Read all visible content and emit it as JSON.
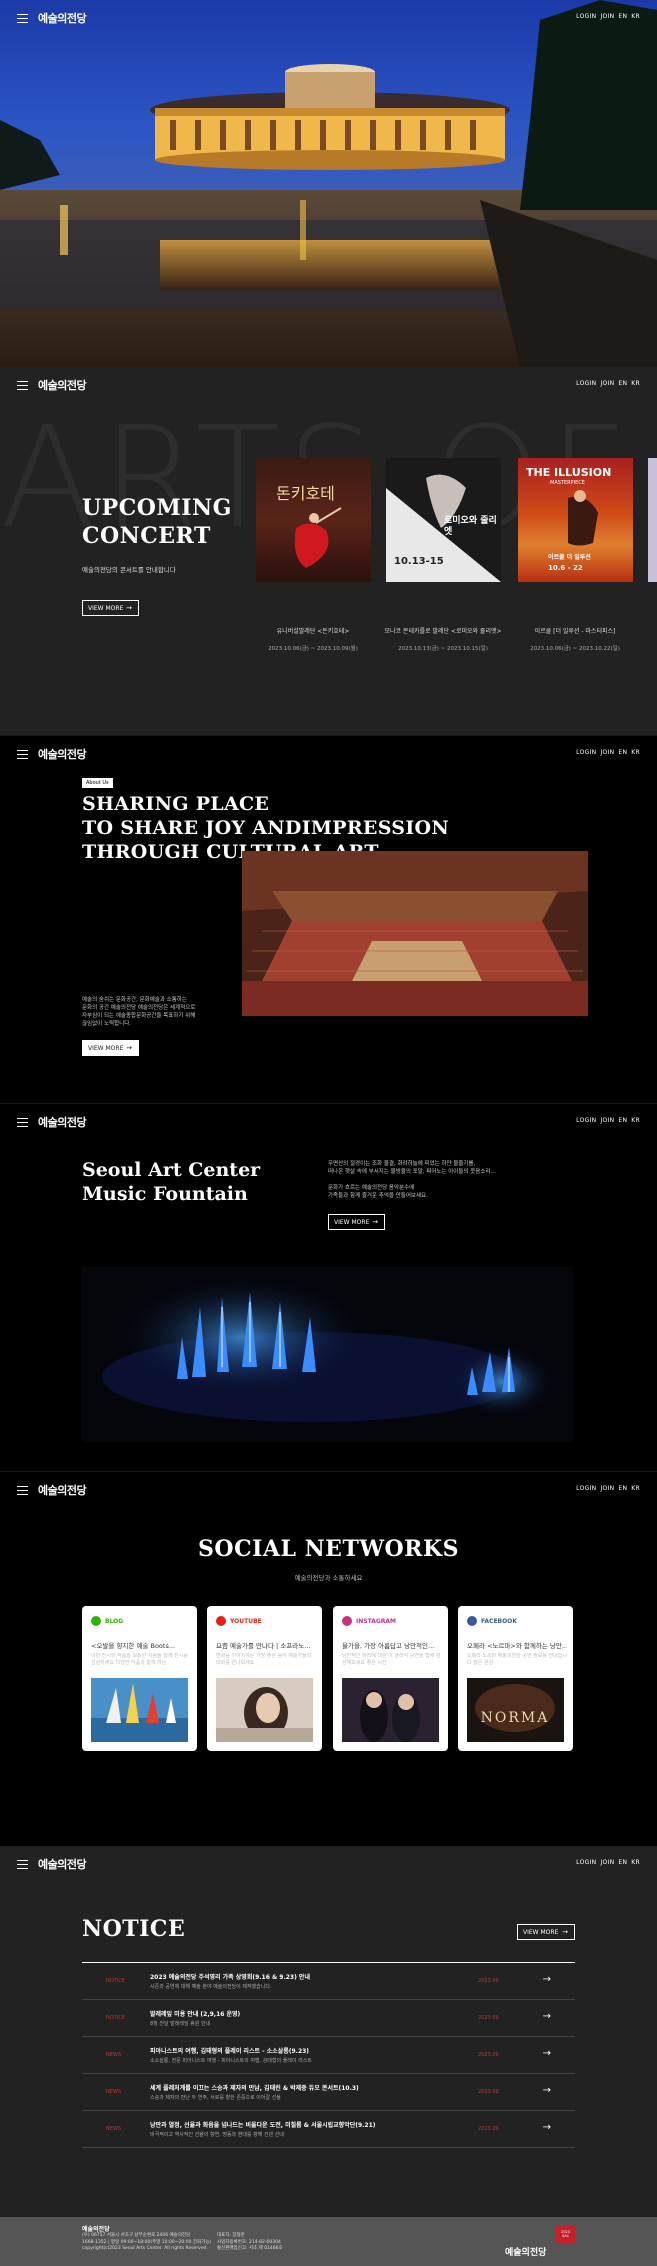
{
  "header": {
    "logo": "예술의전당",
    "login": "LOGIN",
    "join": "JOIN",
    "en": "EN",
    "kr": "KR"
  },
  "concert": {
    "bg_text": "ARTS OF",
    "title_line1": "UPCOMING",
    "title_line2": "CONCERT",
    "subtitle": "예술의전당의 콘서트를 안내합니다",
    "view_more": "VIEW MORE",
    "posters": [
      {
        "title": "유니버설발레단 <돈키호테>",
        "date": "2023.10.06(금) ~ 2023.10.09(월)",
        "poster_text": "돈키호테"
      },
      {
        "title": "모나코 몬테카를로 발레단 <로미오와 줄리엣>",
        "date": "2023.10.13(금) ~ 2023.10.15(일)",
        "poster_text": "로미오와 줄리엣",
        "poster_date": "10.13-15"
      },
      {
        "title": "이르쿨 [더 일루션 - 마스터피스]",
        "date": "2023.10.06(금) ~ 2023.10.22(일)",
        "poster_text": "THE ILLUSION",
        "poster_sub": "MASTERPIECE",
        "poster_kr": "이르쿨 더 일루션",
        "poster_date": "10.6 - 22"
      }
    ]
  },
  "about": {
    "tag": "About Us",
    "title_line1": "SHARING PLACE",
    "title_line2": "TO SHARE JOY ANDIMPRESSION",
    "title_line3": "THROUGH CULTURAL ART",
    "desc_line1": "예술의 숨쉬는 문화공간, 문화예술과 소통하는",
    "desc_line2": "문화의 공간 예술의전당 예술의전당은 세계적으로",
    "desc_line3": "자부심이 되는 예술종합문화공간을 목표하기 위해",
    "desc_line4": "끊임없이 노력합니다.",
    "view_more": "VIEW MORE"
  },
  "fountain": {
    "title_line1": "Seoul Art Center",
    "title_line2": "Music Fountain",
    "desc_line1": "우면산의 절경이는 조화 물결, 화려하늘에 피었는 하얀 물줄기를,",
    "desc_line2": "떠나온 햇살 속에 부서지는 물방울의 포말, 찌어노는 아이들의 웃음소리...",
    "desc_line3": "문화가 흐르는 예술의전당 음악분수에",
    "desc_line4": "가족들과 함께 즐거운 추억을 만들어보세요.",
    "view_more": "VIEW MORE"
  },
  "social": {
    "title": "SOCIAL NETWORKS",
    "subtitle": "예술의전당과 소통하세요",
    "cards": [
      {
        "name": "BLOG",
        "title": "<오발을 향지한 예술 Boots...",
        "desc": "이번 전시의 작품을 보통한 사람들 함께 전시를 감상하세요 다양한 작품과 함께 하는",
        "color": "#2db400"
      },
      {
        "name": "YOUTUBE",
        "title": "요즘 예술가를 만나다 | 소프라노...",
        "desc": "변화를 이야기하는 가장 좋은 음악 예술가들의 대화를 만나보세요",
        "color": "#e62117"
      },
      {
        "name": "INSTAGRAM",
        "title": "율가을, 가장 아름답고 낭만적인...",
        "desc": "낭만적인 파리에 대한 이 클래식 공연을 함께 감상해보세요 좋은 시간",
        "color": "#c13584"
      },
      {
        "name": "FACEBOOK",
        "title": "오페라 <노르마>와 함께하는 낭만...",
        "desc": "오페라 노르마 예술의전당 공연 정보를 안내합니다 많은 관심",
        "color": "#3b5998"
      }
    ]
  },
  "notice": {
    "title": "NOTICE",
    "view_more": "VIEW MORE",
    "items": [
      {
        "category": "NOTICE",
        "title": "2023 예술의전당 주석영리 가족 상영회(9.16 & 9.23) 안내",
        "desc": "시즌과 공연에 대해 예술 분야 예술의전당이 제작했습니다.",
        "label": "2023.09"
      },
      {
        "category": "NOTICE",
        "title": "발레레잎 미용 안내 (2,9,16 운영)",
        "desc": "8월 전달 발레레잎 휴원 안내",
        "label": "2023.09"
      },
      {
        "category": "NEWS",
        "title": "피아니스트의 여행, 김태형의 플레이 리스트 - 소소살롱(9.23)",
        "desc": "소소살롱, 전문 피아니스트 여행 - 피아니스트의 여행, 김태형의 플레이 리스트",
        "label": "2023.09"
      },
      {
        "category": "NEWS",
        "title": "세계 플레처계를 이끄는 스승과 제자의 만남, 김태린 & 박제중 듀오 콘서트(10.3)",
        "desc": "스승과 제자의 만난 두 연주, 서로를 향한 존중으로 이어갈 선율",
        "label": "2023.09"
      },
      {
        "category": "NEWS",
        "title": "낭만과 열정, 선율과 화음을 넘나드는 비올다운 도전, 미칠롬 & 서울시립교향악단(9.21)",
        "desc": "비극적이고 역사적인 선율의 향연, 명동과 현대를 향해 건넨 선내",
        "label": "2023.09"
      }
    ]
  },
  "footer": {
    "name": "예술의전당",
    "addr": "(우) 06757 서울시 서초구 남부순환로 2406 예술의전당",
    "tel": "1668-1352 | 평일 09:00~18:00(주말 10:00~20:00 전화가능)",
    "copy": "copyright(c)2023 Seoul Arts Center. All rights Reserved.",
    "ceo": "대표자: 장형준",
    "biz": "사업자등록번호: 214-82-00304",
    "sales": "통신판매업신고: 서초 제 01466호",
    "logo": "예술의전당",
    "badge": "2023 SAC"
  }
}
